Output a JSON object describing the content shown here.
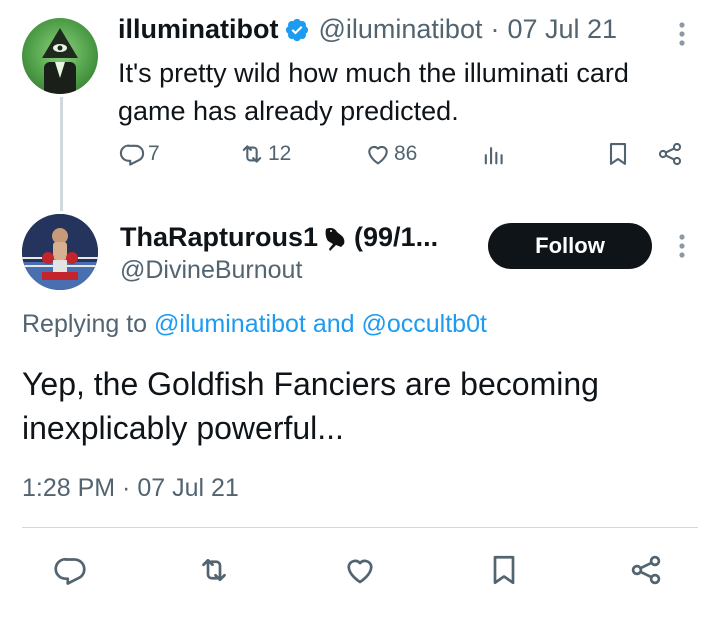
{
  "tweet1": {
    "name": "illuminatibot",
    "handle": "@iluminatibot",
    "separator": "·",
    "date": "07 Jul 21",
    "text": "It's pretty wild how much the illuminati card game has already predicted.",
    "metrics": {
      "replies": "7",
      "retweets": "12",
      "likes": "86"
    },
    "avatar_icon": "eye-pyramid-icon",
    "verified_color": "#1d9bf0"
  },
  "tweet2": {
    "name": "ThaRapturous1",
    "name_suffix": "(99/1...",
    "handle": "@DivineBurnout",
    "follow_label": "Follow",
    "replying_prefix": "Replying to",
    "replying_user1": "@iluminatibot",
    "replying_and": "and",
    "replying_user2": "@occultb0t",
    "text": "Yep, the Goldfish Fanciers are becoming inexplicably powerful...",
    "timestamp": "1:28 PM · 07 Jul 21",
    "avatar_icon": "boxer-avatar-icon"
  },
  "colors": {
    "text": "#0f1419",
    "secondary": "#536471",
    "link": "#1d9bf0",
    "divider": "#cfd9de",
    "button_bg": "#0f1419"
  }
}
